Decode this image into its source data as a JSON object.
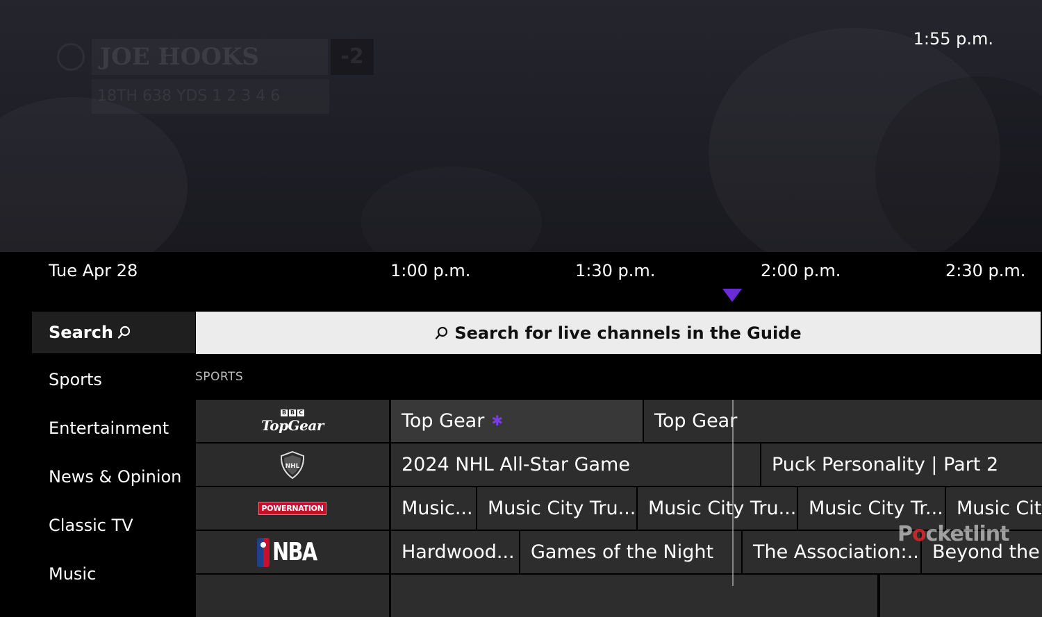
{
  "preview": {
    "clock": "1:55 p.m.",
    "scorebug": {
      "player": "JOE HOOKS",
      "score": "-2",
      "stats": "18TH 638 YDS  1 2 3 4 6"
    }
  },
  "timeline": {
    "date": "Tue Apr 28",
    "times": [
      "1:00 p.m.",
      "1:30 p.m.",
      "2:00 p.m.",
      "2:30 p.m."
    ]
  },
  "menu": {
    "items": [
      {
        "label": "Search"
      },
      {
        "label": "Sports"
      },
      {
        "label": "Entertainment"
      },
      {
        "label": "News & Opinion"
      },
      {
        "label": "Classic TV"
      },
      {
        "label": "Music"
      }
    ]
  },
  "search_bar": {
    "label": "Search for live channels in the Guide"
  },
  "section": {
    "label": "SPORTS"
  },
  "channels": [
    {
      "logo": {
        "bbc": [
          "B",
          "B",
          "C"
        ],
        "name": "TopGear"
      },
      "programs": [
        "Top Gear",
        "Top Gear"
      ]
    },
    {
      "logo": {
        "name": "NHL"
      },
      "programs": [
        "2024 NHL All-Star Game",
        "Puck Personality | Part 2"
      ]
    },
    {
      "logo": {
        "name": "POWERNATION"
      },
      "programs": [
        "Music...",
        "Music City Tru...",
        "Music City Tru...",
        "Music City Tr...",
        "Music City"
      ]
    },
    {
      "logo": {
        "name": "NBA"
      },
      "programs": [
        "Hardwood...",
        "Games of the Night",
        "The Association:...",
        "Beyond the I"
      ]
    }
  ],
  "watermark": {
    "p": "P",
    "o": "o",
    "rest": "cketlint"
  },
  "colors": {
    "accent_purple": "#6a2cd6",
    "search_bar_bg": "#ececec",
    "menu_selected_bg": "#1f1f1f",
    "cell_bg": "#2d2d2d"
  }
}
